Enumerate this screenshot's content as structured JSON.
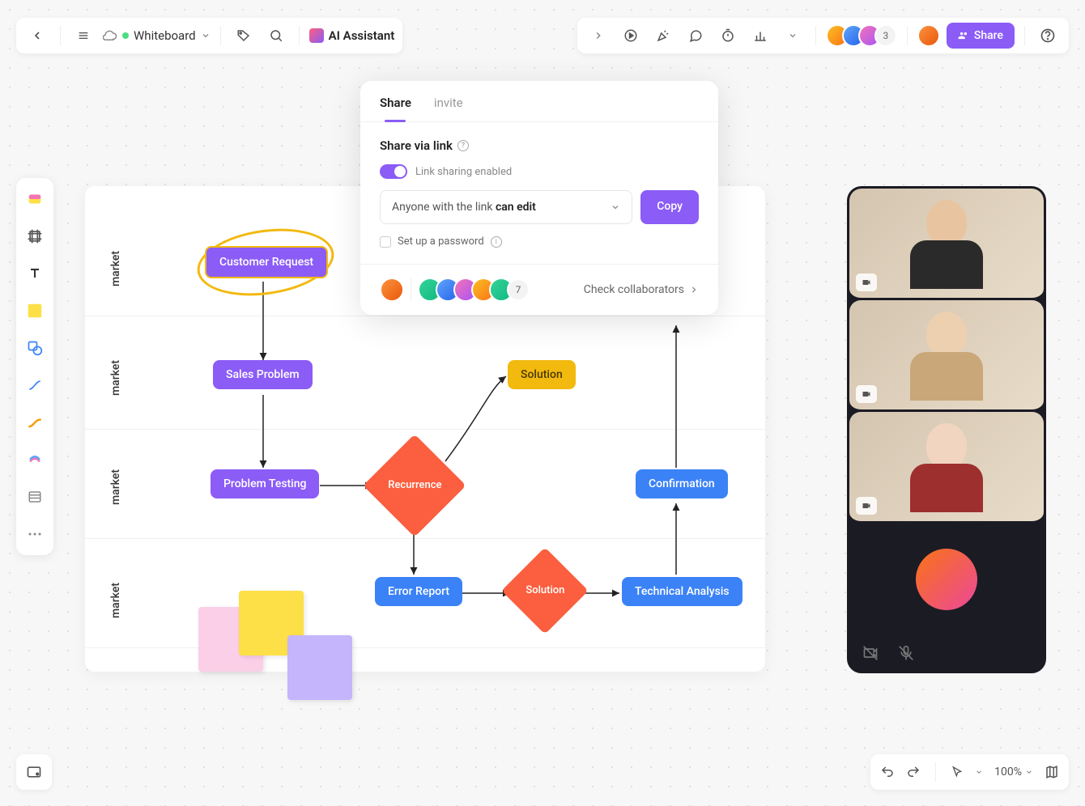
{
  "topbar": {
    "doc_name": "Whiteboard",
    "ai_label": "AI Assistant",
    "avatar_count": "3",
    "share_label": "Share"
  },
  "share_popover": {
    "tabs": {
      "share": "Share",
      "invite": "invite"
    },
    "heading": "Share via link",
    "toggle_label": "Link sharing enabled",
    "perm_prefix": "Anyone with the link ",
    "perm_value": "can edit",
    "copy_label": "Copy",
    "password_label": "Set up a password",
    "collab_count": "7",
    "collab_link": "Check collaborators"
  },
  "canvas": {
    "row_labels": [
      "market",
      "market",
      "market",
      "market"
    ],
    "nodes": {
      "customer_request": "Customer Request",
      "sales_problem": "Sales Problem",
      "problem_testing": "Problem Testing",
      "recurrence": "Recurrence",
      "solution_top": "Solution",
      "error_report": "Error Report",
      "solution_bottom": "Solution",
      "technical_analysis": "Technical Analysis",
      "confirmation": "Confirmation"
    }
  },
  "bottom": {
    "zoom": "100%"
  }
}
